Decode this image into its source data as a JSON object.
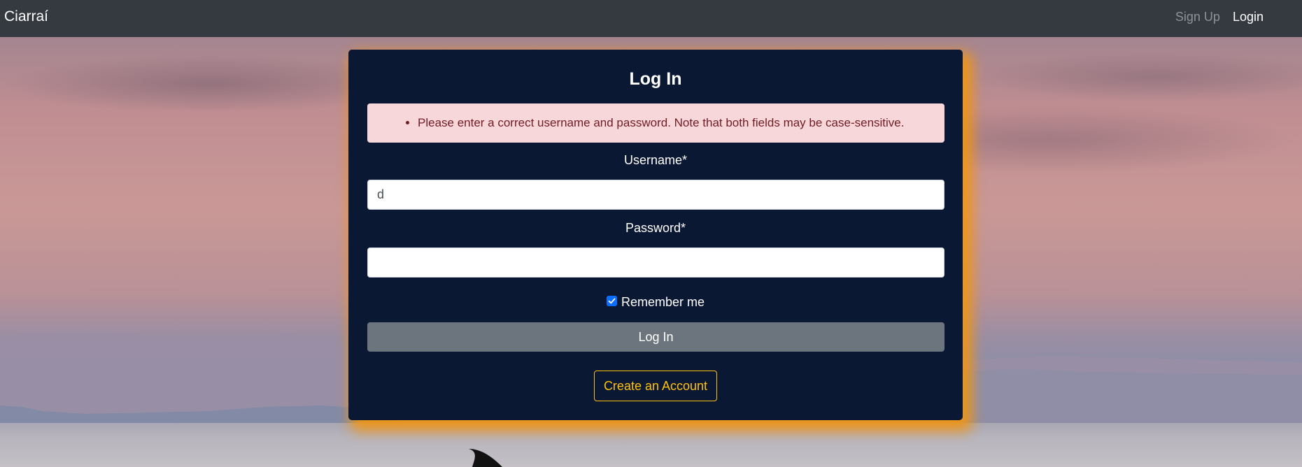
{
  "navbar": {
    "brand": "Ciarraí",
    "links": [
      {
        "label": "Sign Up",
        "active": false
      },
      {
        "label": "Login",
        "active": true
      }
    ]
  },
  "form": {
    "title": "Log In",
    "error_message": "Please enter a correct username and password. Note that both fields may be case-sensitive.",
    "username_label": "Username*",
    "username_value": "d",
    "password_label": "Password*",
    "password_value": "",
    "remember_label": "Remember me",
    "remember_checked": true,
    "submit_label": "Log In",
    "create_account_label": "Create an Account"
  },
  "icons": {
    "checkbox": "checkmark-icon"
  },
  "colors": {
    "navbar": "#343a40",
    "card": "#0b1833",
    "card_glow": "#f0961e",
    "alert_bg": "#f8d7da",
    "alert_text": "#721c24",
    "submit_button": "#6c757d",
    "create_button": "#ffc107",
    "checkbox": "#0d6efd"
  }
}
